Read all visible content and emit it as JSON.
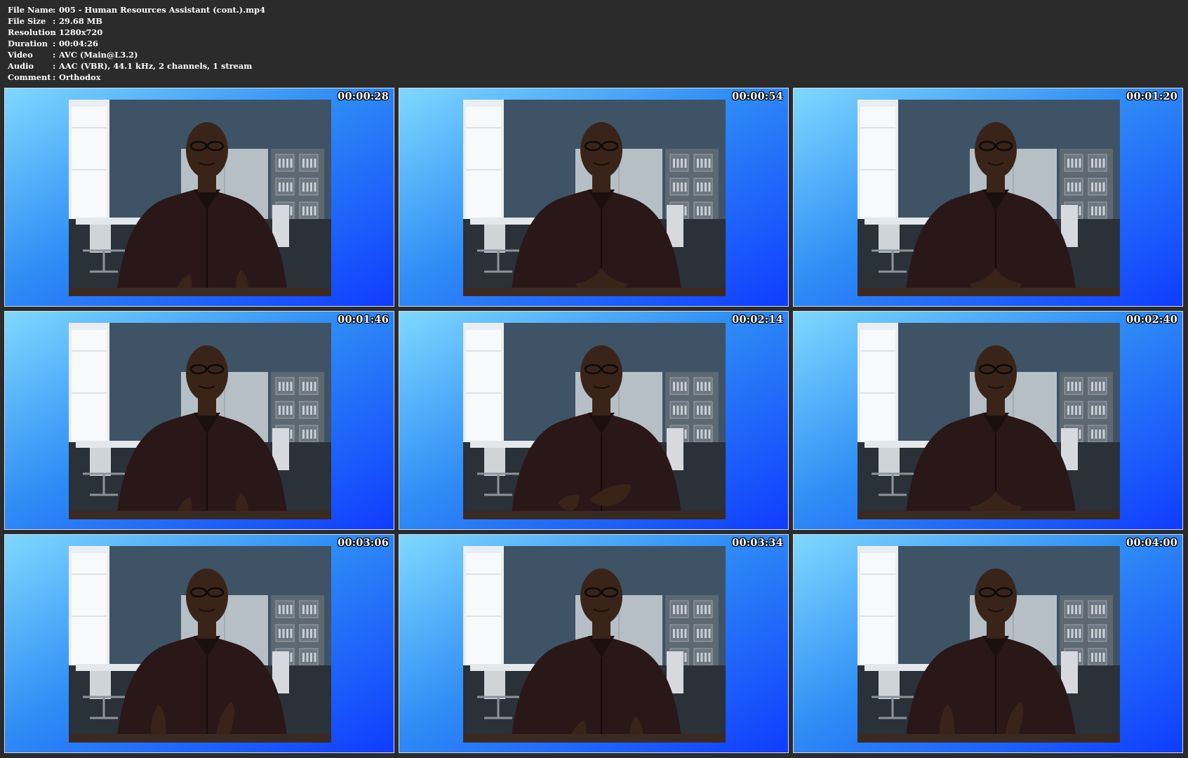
{
  "file_info": [
    {
      "key": "File Name",
      "sep": ":",
      "value": "005 - Human Resources Assistant (cont.).mp4"
    },
    {
      "key": "File Size",
      "sep": ":",
      "value": "29.68 MB"
    },
    {
      "key": "Resolution",
      "sep": ":",
      "value": "1280x720"
    },
    {
      "key": "Duration",
      "sep": ":",
      "value": "00:04:26"
    },
    {
      "key": "Video",
      "sep": ":",
      "value": "AVC (Main@L3.2)"
    },
    {
      "key": "Audio",
      "sep": ":",
      "value": "AAC (VBR), 44.1 kHz, 2 channels, 1 stream"
    },
    {
      "key": "Comment",
      "sep": ":",
      "value": "Orthodox"
    }
  ],
  "thumbnails": [
    {
      "timestamp": "00:00:28",
      "hands": "open"
    },
    {
      "timestamp": "00:00:54",
      "hands": "steeple"
    },
    {
      "timestamp": "00:01:20",
      "hands": "steeple"
    },
    {
      "timestamp": "00:01:46",
      "hands": "open"
    },
    {
      "timestamp": "00:02:14",
      "hands": "gesture"
    },
    {
      "timestamp": "00:02:40",
      "hands": "steeple"
    },
    {
      "timestamp": "00:03:06",
      "hands": "raised"
    },
    {
      "timestamp": "00:03:34",
      "hands": "open"
    },
    {
      "timestamp": "00:04:00",
      "hands": "raised"
    }
  ],
  "colors": {
    "background": "#2b2b2b",
    "thumb_gradient_light": "#7fd8ff",
    "thumb_gradient_dark": "#0f3cff",
    "wall": "#3f5367",
    "shirt": "#2a1717",
    "skin": "#3a2419"
  }
}
